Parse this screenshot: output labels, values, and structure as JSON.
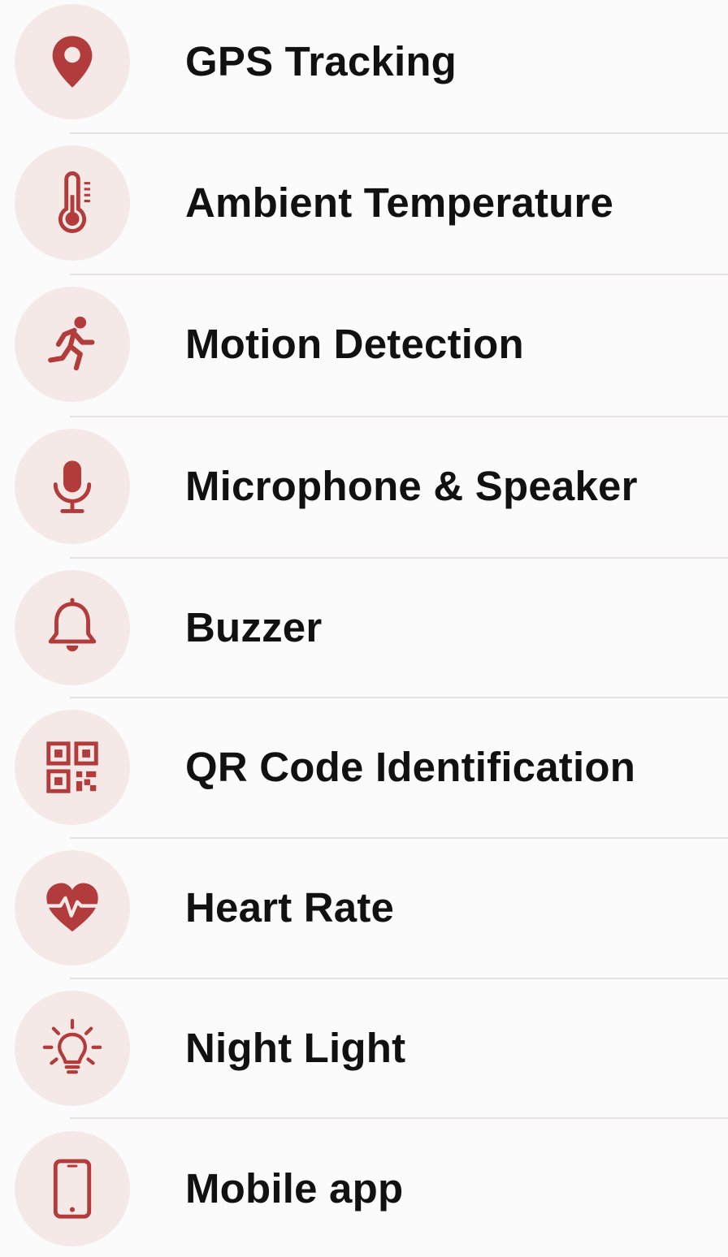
{
  "accent_color": "#b23b3b",
  "features": [
    {
      "label": "GPS Tracking",
      "icon": "location-pin-icon"
    },
    {
      "label": "Ambient Temperature",
      "icon": "thermometer-icon"
    },
    {
      "label": "Motion Detection",
      "icon": "running-person-icon"
    },
    {
      "label": "Microphone & Speaker",
      "icon": "microphone-icon"
    },
    {
      "label": "Buzzer",
      "icon": "bell-icon"
    },
    {
      "label": "QR Code Identification",
      "icon": "qr-code-icon"
    },
    {
      "label": "Heart Rate",
      "icon": "heart-rate-icon"
    },
    {
      "label": "Night Light",
      "icon": "lightbulb-icon"
    },
    {
      "label": "Mobile app",
      "icon": "mobile-phone-icon"
    }
  ]
}
